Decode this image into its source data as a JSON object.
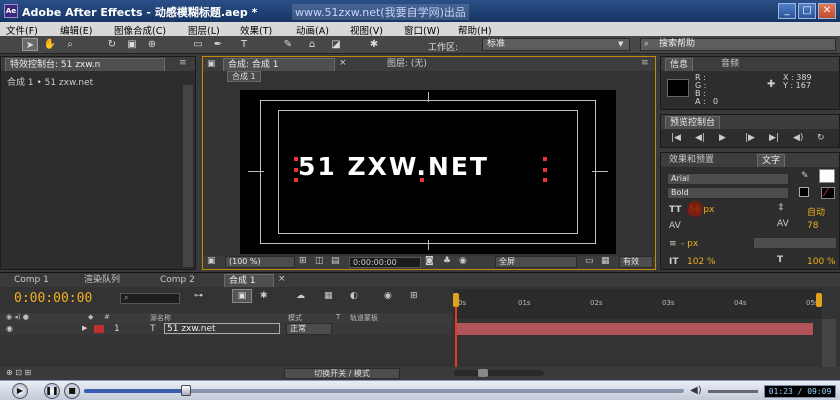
{
  "window": {
    "app_title": "Adobe After Effects - 动感模糊标题.aep *",
    "watermark": "www.51zxw.net(我要自学网)出品",
    "logo": "Ae",
    "minimize": "_",
    "maximize": "□",
    "close": "✕"
  },
  "menu": [
    "文件(F)",
    "编辑(E)",
    "图像合成(C)",
    "图层(L)",
    "效果(T)",
    "动画(A)",
    "视图(V)",
    "窗口(W)",
    "帮助(H)"
  ],
  "toolbar": {
    "workspace_label": "工作区:",
    "workspace_value": "标准",
    "search_placeholder": "搜索帮助"
  },
  "effects_panel": {
    "tab_label": "特效控制台: 51 zxw.n",
    "breadcrumb": "合成 1 • 51 zxw.net"
  },
  "comp_panel": {
    "tab_comp": "合成: 合成 1",
    "tab_layer": "图层: (无)",
    "subtab": "合成 1",
    "composition_text": "51 ZXW.NET",
    "zoom": "(100 %)",
    "timecode": "0:00:00:00",
    "resolution": "全屏",
    "view_option": "有效"
  },
  "info_panel": {
    "tab_info": "信息",
    "tab_audio": "音频",
    "r_label": "R :",
    "g_label": "G :",
    "b_label": "B :",
    "a_label": "A :",
    "a_value": "0",
    "x_label": "X : 389",
    "y_label": "Y : 167"
  },
  "preview_panel": {
    "tab": "预览控制台"
  },
  "char_panel": {
    "tab_effects": "效果和预置",
    "tab_text": "文字",
    "font": "Arial",
    "style": "Bold",
    "size": "56 px",
    "leading": "自动",
    "tracking": "78",
    "stroke": "- px",
    "vert_scale": "102 %",
    "horiz_scale": "100 %"
  },
  "timeline": {
    "tab_comp2a": "Comp 1",
    "tab_render": "渲染队列",
    "tab_comp2": "Comp 2",
    "tab_main": "合成 1",
    "timecode": "0:00:00:00",
    "ruler": [
      "0s",
      "01s",
      "02s",
      "03s",
      "04s",
      "05s"
    ],
    "col_source": "源名称",
    "col_mode": "模式",
    "col_t": "T",
    "col_track": "轨道蒙板",
    "layer_number": "1",
    "layer_name": "51 zxw.net",
    "layer_mode": "正常",
    "switch_label": "切换开关 / 模式"
  },
  "player": {
    "time": "01:23 / 09:09",
    "progress": 0.17
  }
}
